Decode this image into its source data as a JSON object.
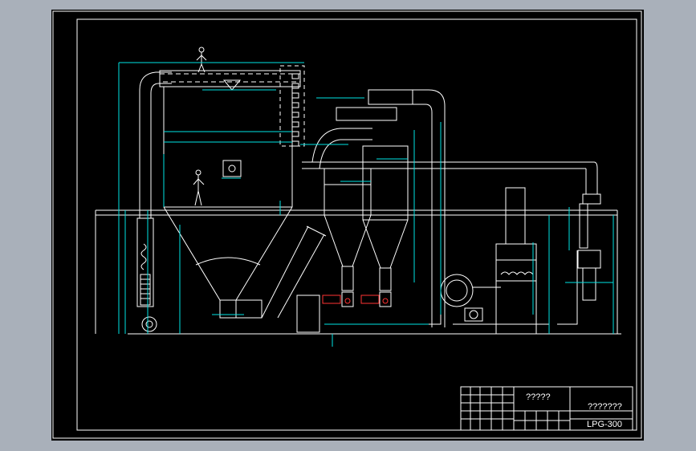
{
  "drawing": {
    "background": "#000000",
    "frame_color": "#ffffff",
    "line_color": "#ffffff",
    "dim_color": "#00e5e5",
    "accent_color": "#ff3333"
  },
  "title_block": {
    "drawing_title": "?????",
    "company": "???????",
    "drawing_number": "LPG-300"
  }
}
